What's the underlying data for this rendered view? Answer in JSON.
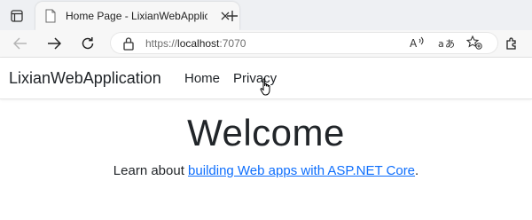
{
  "browser": {
    "tab": {
      "title": "Home Page - LixianWebApplicatio"
    },
    "address": {
      "protocol": "https://",
      "host": "localhost",
      "port": ":7070"
    },
    "icons": [
      "window-menu-icon",
      "page-favicon-icon",
      "close-icon",
      "plus-icon",
      "back-arrow-icon",
      "forward-arrow-icon",
      "refresh-icon",
      "lock-icon",
      "read-aloud-icon",
      "translate-icon",
      "favorite-star-icon",
      "extensions-icon"
    ]
  },
  "site": {
    "brand": "LixianWebApplication",
    "nav": [
      {
        "label": "Home"
      },
      {
        "label": "Privacy"
      }
    ]
  },
  "main": {
    "heading": "Welcome",
    "learn_prefix": "Learn about ",
    "learn_link": "building Web apps with ASP.NET Core",
    "learn_suffix": "."
  },
  "colors": {
    "link": "#0d6efd",
    "tabstrip": "#eef0f3",
    "toolbar": "#f7f7f7"
  }
}
